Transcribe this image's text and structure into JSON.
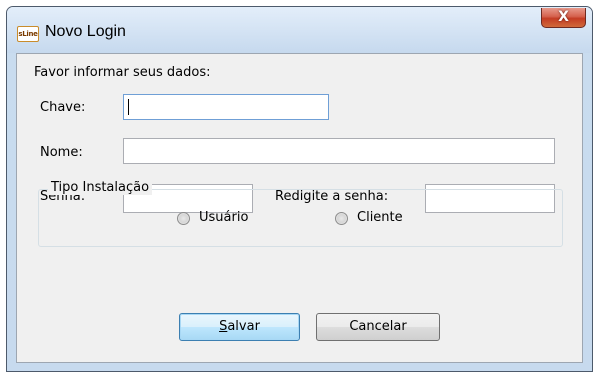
{
  "window": {
    "title": "Novo Login",
    "icon_label": "sLine",
    "close_symbol": "X"
  },
  "form": {
    "intro": "Favor informar seus dados:",
    "chave_label": "Chave:",
    "chave_value": "",
    "nome_label": "Nome:",
    "nome_value": "",
    "senha_label": "Senha:",
    "senha_value": "",
    "redigite_label": "Redigite a senha:",
    "redigite_value": ""
  },
  "install_type": {
    "title": "Tipo Instalação",
    "options": [
      {
        "label": "Usuário",
        "selected": false
      },
      {
        "label": "Cliente",
        "selected": false
      }
    ]
  },
  "buttons": {
    "save": "Salvar",
    "cancel": "Cancelar"
  }
}
